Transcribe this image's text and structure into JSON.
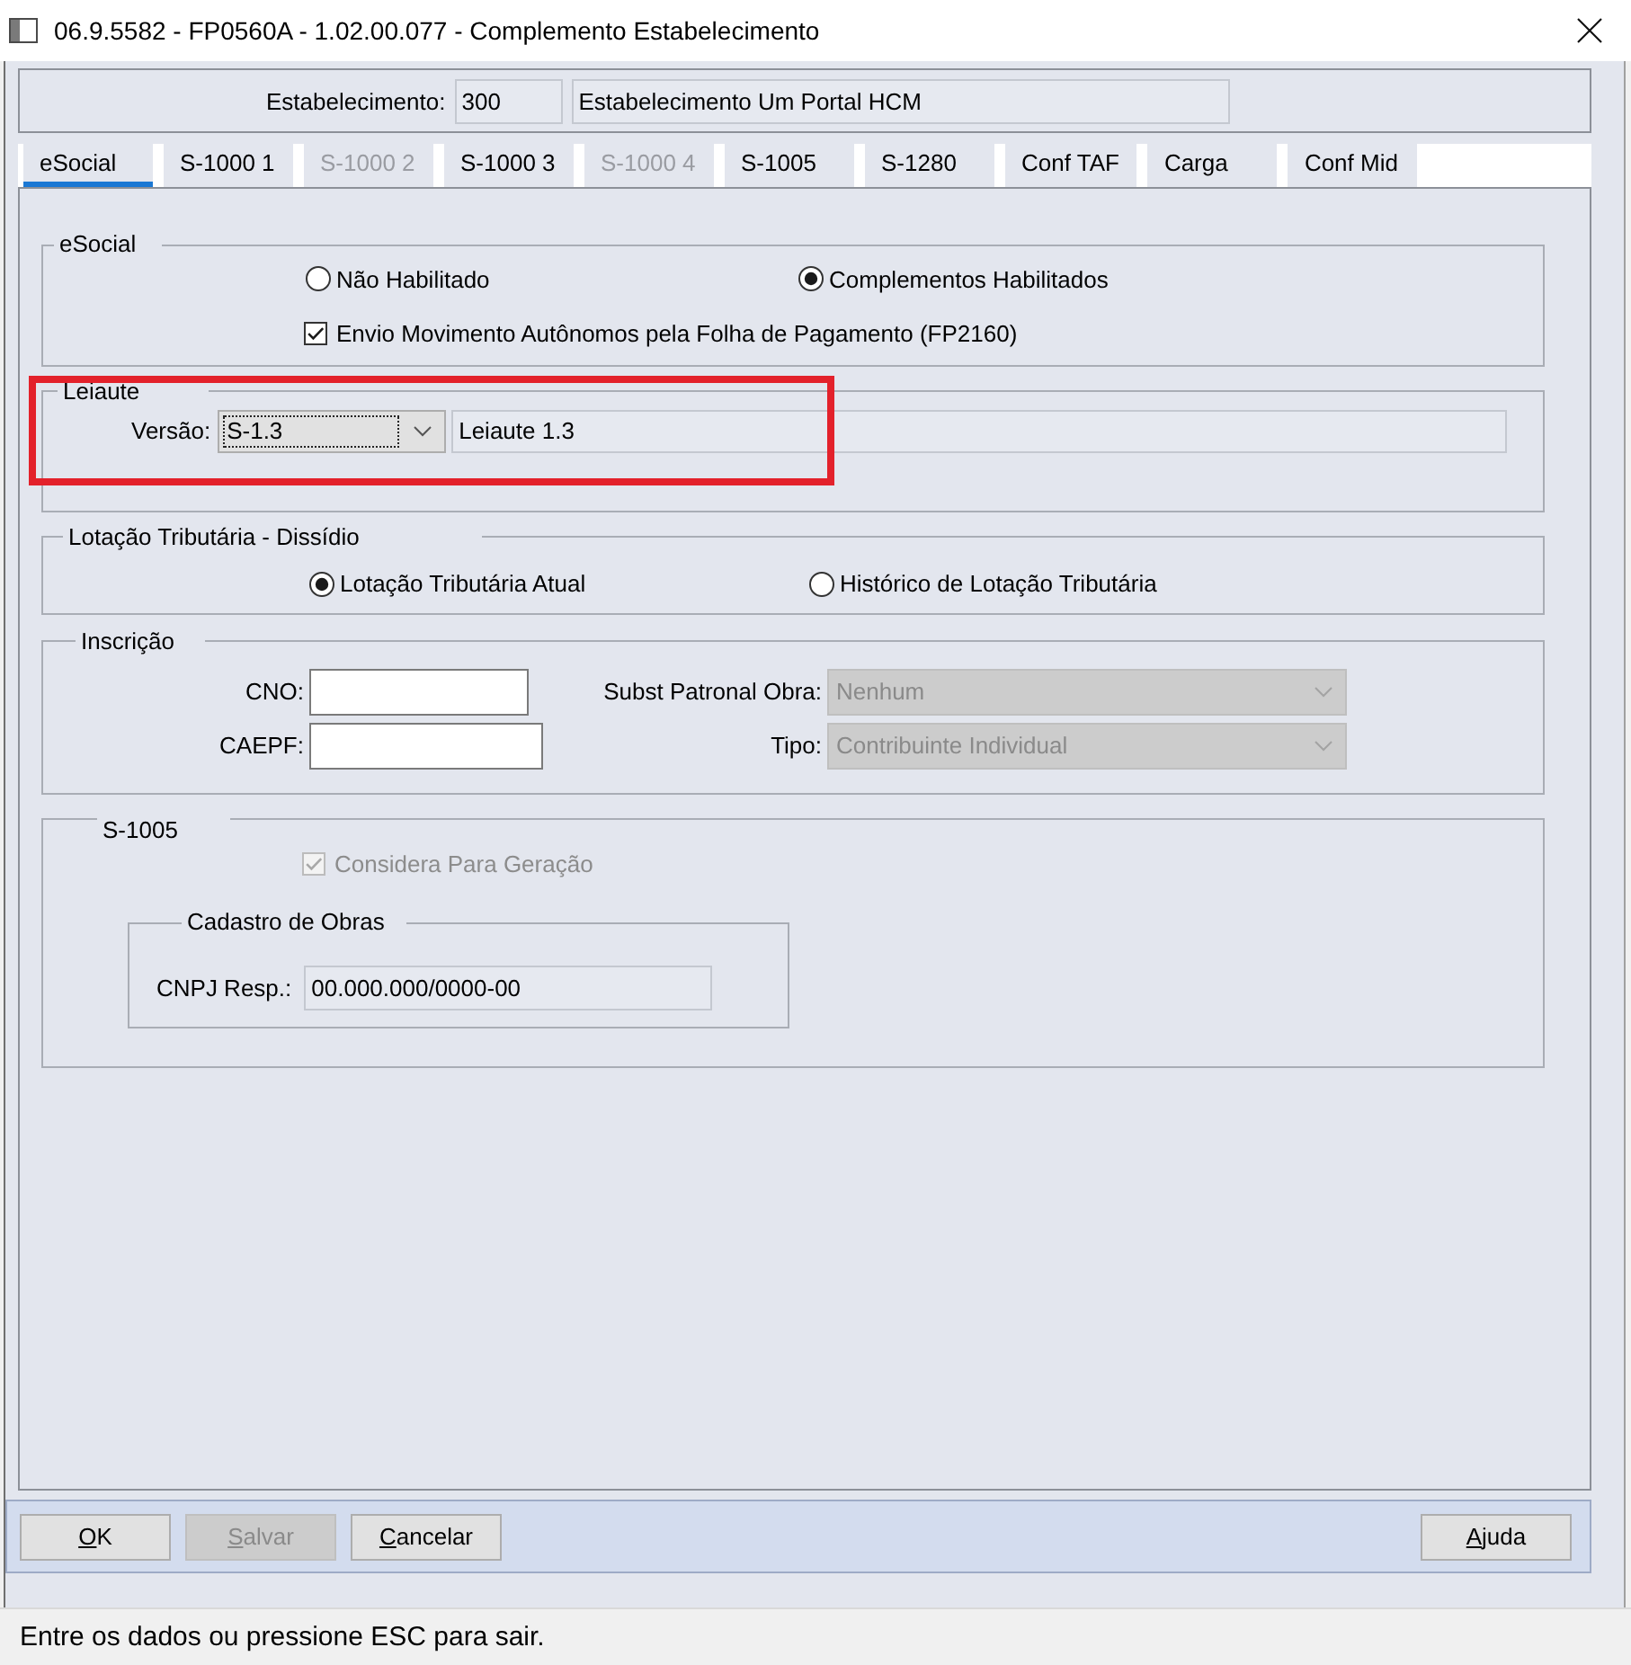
{
  "window": {
    "title": "06.9.5582 - FP0560A - 1.02.00.077 - Complemento Estabelecimento"
  },
  "header": {
    "label": "Estabelecimento:",
    "code": "300",
    "name": "Estabelecimento Um Portal HCM"
  },
  "tabs": [
    {
      "label": "eSocial",
      "selected": true,
      "disabled": false
    },
    {
      "label": "S-1000 1",
      "selected": false,
      "disabled": false
    },
    {
      "label": "S-1000 2",
      "selected": false,
      "disabled": true
    },
    {
      "label": "S-1000 3",
      "selected": false,
      "disabled": false
    },
    {
      "label": "S-1000 4",
      "selected": false,
      "disabled": true
    },
    {
      "label": "S-1005",
      "selected": false,
      "disabled": false
    },
    {
      "label": "S-1280",
      "selected": false,
      "disabled": false
    },
    {
      "label": "Conf TAF",
      "selected": false,
      "disabled": false
    },
    {
      "label": "Carga",
      "selected": false,
      "disabled": false
    },
    {
      "label": "Conf Mid",
      "selected": false,
      "disabled": false
    }
  ],
  "esocial_group": {
    "title": "eSocial",
    "radios": [
      {
        "label": "Não Habilitado",
        "selected": false
      },
      {
        "label": "Complementos Habilitados",
        "selected": true
      }
    ],
    "checkbox": {
      "label": "Envio Movimento Autônomos pela Folha de Pagamento (FP2160)",
      "checked": true,
      "disabled": false
    }
  },
  "leiaute_group": {
    "title": "Leiaute",
    "highlighted": true,
    "version_label": "Versão:",
    "version_value": "S-1.3",
    "description": "Leiaute 1.3"
  },
  "lotacao_group": {
    "title": "Lotação Tributária - Dissídio",
    "radios": [
      {
        "label": "Lotação Tributária Atual",
        "selected": true
      },
      {
        "label": "Histórico de Lotação Tributária",
        "selected": false
      }
    ]
  },
  "inscricao_group": {
    "title": "Inscrição",
    "fields": [
      {
        "label": "CNO:"
      },
      {
        "label": "CAEPF:"
      }
    ],
    "dropdowns": [
      {
        "label": "Subst Patronal Obra:",
        "value": "Nenhum",
        "disabled": true
      },
      {
        "label": "Tipo:",
        "value": "Contribuinte Individual",
        "disabled": true
      }
    ]
  },
  "s1005_group": {
    "title": "S-1005",
    "checkbox": {
      "label": "Considera Para Geração",
      "checked": true,
      "disabled": true
    },
    "obras_group": {
      "title": "Cadastro de Obras",
      "label": "CNPJ Resp.:",
      "value": "00.000.000/0000-00"
    }
  },
  "button_bar": {
    "left": [
      {
        "label": "OK",
        "disabled": false
      },
      {
        "label": "Salvar",
        "disabled": true
      },
      {
        "label": "Cancelar",
        "disabled": false
      }
    ],
    "right": [
      {
        "label": "Ajuda",
        "disabled": false
      }
    ]
  },
  "status_bar": {
    "text": "Entre os dados ou pressione ESC para sair."
  }
}
